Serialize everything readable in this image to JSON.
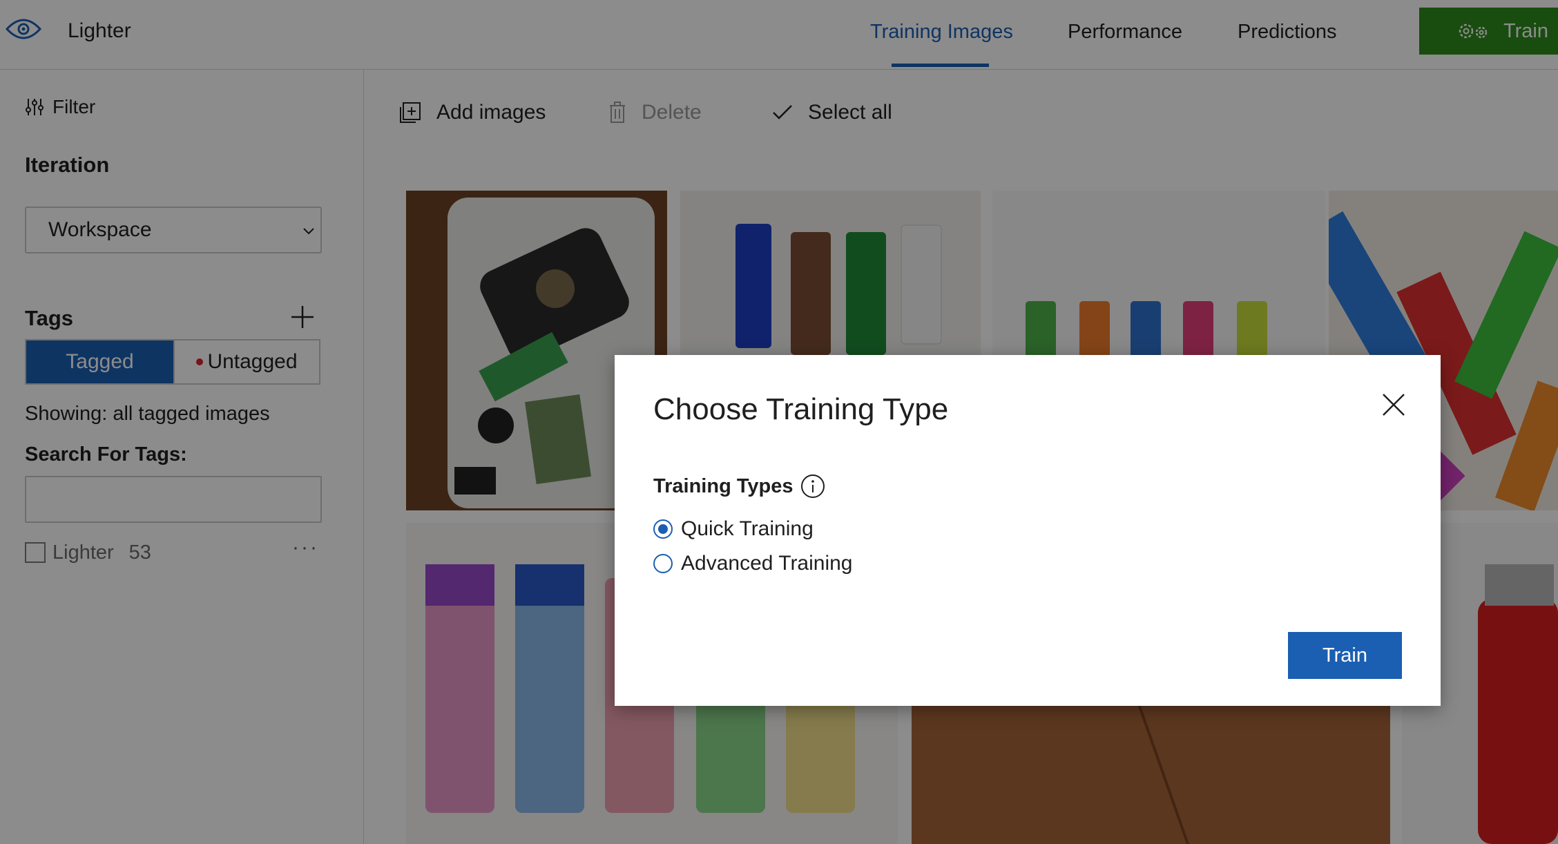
{
  "app": {
    "name": "Lighter"
  },
  "tabs": [
    {
      "label": "Training Images",
      "active": true
    },
    {
      "label": "Performance",
      "active": false
    },
    {
      "label": "Predictions",
      "active": false
    }
  ],
  "top_train": {
    "label": "Train",
    "icon": "gears-icon"
  },
  "sidebar": {
    "filter_label": "Filter",
    "iteration_label": "Iteration",
    "iteration_value": "Workspace",
    "tags_label": "Tags",
    "tagged_label": "Tagged",
    "untagged_label": "Untagged",
    "showing": "Showing: all tagged images",
    "search_label": "Search For Tags:",
    "search_value": "",
    "tag_items": [
      {
        "name": "Lighter",
        "count": "53"
      }
    ],
    "more_label": "···"
  },
  "toolbar": {
    "add_images": "Add images",
    "delete": "Delete",
    "select_all": "Select all"
  },
  "dialog": {
    "title": "Choose Training Type",
    "types_label": "Training Types",
    "options": [
      {
        "label": "Quick Training",
        "checked": true
      },
      {
        "label": "Advanced Training",
        "checked": false
      }
    ],
    "train_label": "Train"
  },
  "colors": {
    "accent": "#1b5fb2",
    "train_green": "#2f8a1c",
    "untagged_dot": "#d9232e"
  }
}
